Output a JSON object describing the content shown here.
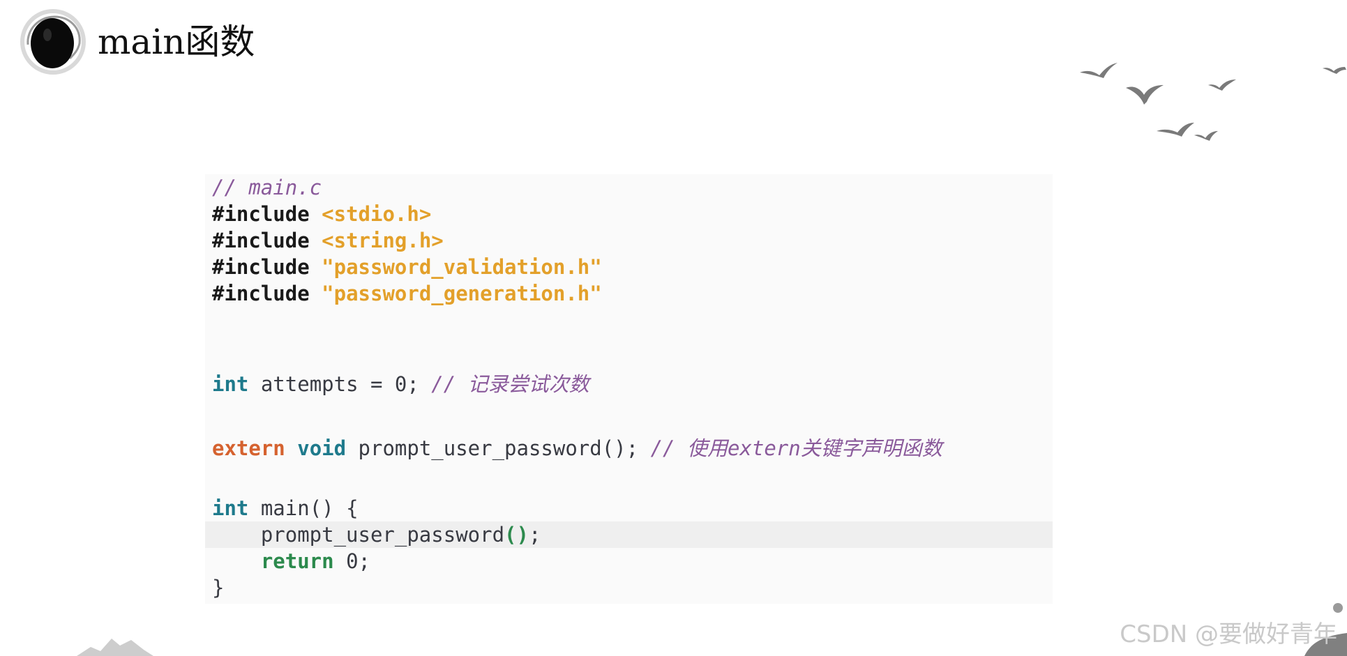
{
  "slide": {
    "title": "main函数",
    "watermark": "CSDN @要做好青年"
  },
  "code": {
    "language": "c",
    "lines": [
      {
        "tokens": [
          {
            "t": "// main.c",
            "k": "comment"
          }
        ]
      },
      {
        "tokens": [
          {
            "t": "#include",
            "k": "pre"
          },
          {
            "t": " ",
            "k": "plain"
          },
          {
            "t": "<stdio.h>",
            "k": "str"
          }
        ]
      },
      {
        "tokens": [
          {
            "t": "#include",
            "k": "pre"
          },
          {
            "t": " ",
            "k": "plain"
          },
          {
            "t": "<string.h>",
            "k": "str"
          }
        ]
      },
      {
        "tokens": [
          {
            "t": "#include",
            "k": "pre"
          },
          {
            "t": " ",
            "k": "plain"
          },
          {
            "t": "\"password_validation.h\"",
            "k": "str"
          }
        ]
      },
      {
        "tokens": [
          {
            "t": "#include",
            "k": "pre"
          },
          {
            "t": " ",
            "k": "plain"
          },
          {
            "t": "\"password_generation.h\"",
            "k": "str"
          }
        ]
      },
      {
        "tokens": []
      },
      {
        "tokens": []
      },
      {
        "tokens": [
          {
            "t": "int",
            "k": "type"
          },
          {
            "t": " attempts = 0; ",
            "k": "plain"
          },
          {
            "t": "// 记录尝试次数",
            "k": "comment"
          }
        ]
      },
      {
        "tokens": []
      },
      {
        "tokens": [
          {
            "t": "extern",
            "k": "kw-extern"
          },
          {
            "t": " ",
            "k": "plain"
          },
          {
            "t": "void",
            "k": "type"
          },
          {
            "t": " prompt_user_password(); ",
            "k": "plain"
          },
          {
            "t": "// 使用extern关键字声明函数",
            "k": "comment"
          }
        ]
      },
      {
        "tokens": []
      },
      {
        "tokens": [
          {
            "t": "int",
            "k": "type"
          },
          {
            "t": " main() {",
            "k": "plain"
          }
        ]
      },
      {
        "tokens": [
          {
            "t": "    prompt_user_password",
            "k": "plain"
          },
          {
            "t": "()",
            "k": "paren"
          },
          {
            "t": ";",
            "k": "plain"
          }
        ],
        "highlight": true
      },
      {
        "tokens": [
          {
            "t": "    ",
            "k": "plain"
          },
          {
            "t": "return",
            "k": "kw-ret"
          },
          {
            "t": " 0;",
            "k": "plain"
          }
        ]
      },
      {
        "tokens": [
          {
            "t": "}",
            "k": "plain"
          }
        ]
      }
    ]
  },
  "colors": {
    "comment": "#8a5a9b",
    "string": "#e3a02a",
    "type": "#1e7a8c",
    "extern": "#d5622f",
    "return": "#2c8a4d",
    "code_background": "#fafafa",
    "line_highlight": "#efefef"
  },
  "icons": {
    "title_mark": "ink-circle-icon",
    "decoration": "flying-birds-icon"
  }
}
